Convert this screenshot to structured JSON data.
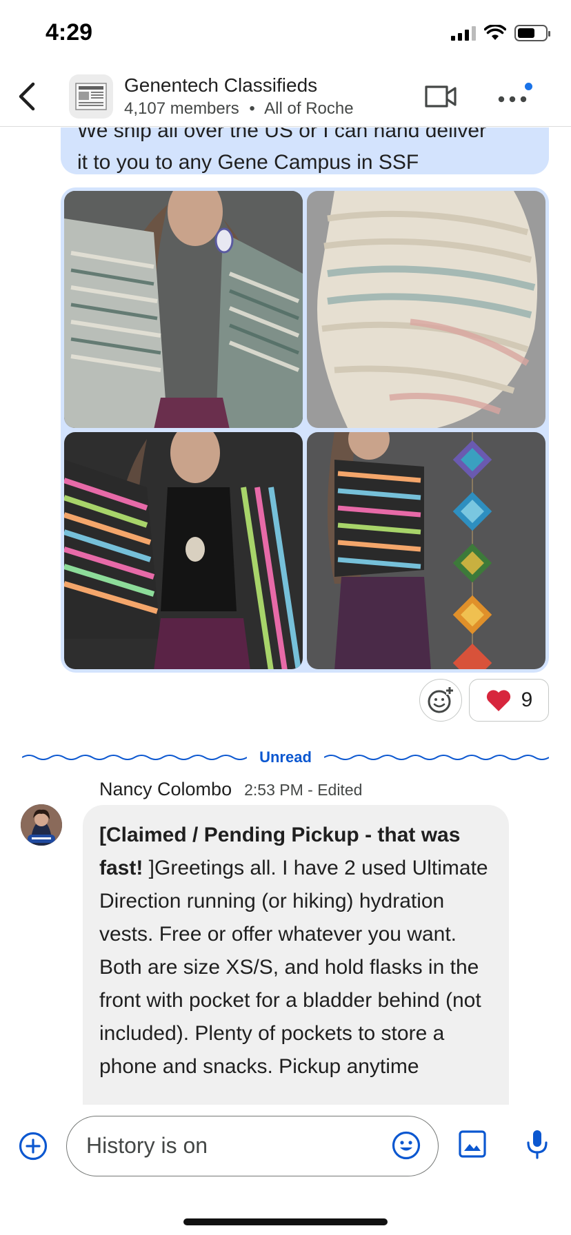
{
  "status_bar": {
    "time": "4:29"
  },
  "header": {
    "back_icon": "chevron-left-icon",
    "group_avatar_icon": "newspaper-icon",
    "title": "Genentech Classifieds",
    "members": "4,107 members",
    "separator": "•",
    "audience": "All of Roche",
    "video_icon": "video-camera-icon",
    "more_icon": "more-horizontal-icon",
    "notification_dot_color": "#1a73e8"
  },
  "messages": {
    "previous": {
      "text_partial": "We ship all over the US or I can hand deliver",
      "text": "it to you to any Gene Campus in SSF",
      "bubble_color": "#d3e3fd",
      "photos": [
        {
          "icon": "photo-cardigan-granny-square-gray"
        },
        {
          "icon": "photo-cream-crochet-sweater"
        },
        {
          "icon": "photo-cardigan-multicolor-black"
        },
        {
          "icon": "photo-cardigan-multicolor-ojos-de-dios"
        }
      ],
      "reactions": {
        "add_reaction_icon": "add-reaction-icon",
        "heart_emoji": "heart-icon",
        "heart_count": "9"
      }
    },
    "unread_divider": {
      "label": "Unread",
      "color": "#0b57d0"
    },
    "current": {
      "sender": "Nancy Colombo",
      "time": "2:53 PM - Edited",
      "avatar_icon": "user-avatar-icon",
      "bold_prefix": "[Claimed / Pending Pickup - that was fast!",
      "body": " ]Greetings all. I have 2 used Ultimate Direction running (or hiking) hydration vests. Free or offer whatever you want. Both are size XS/S, and hold flasks in the front with pocket for a bladder behind (not included). Plenty of pockets to store a phone and snacks. Pickup anytime"
    }
  },
  "composer": {
    "add_icon": "add-circle-icon",
    "input_text": "History is on",
    "emoji_icon": "emoji-icon",
    "image_icon": "image-icon",
    "mic_icon": "microphone-icon",
    "accent_color": "#0b57d0"
  }
}
